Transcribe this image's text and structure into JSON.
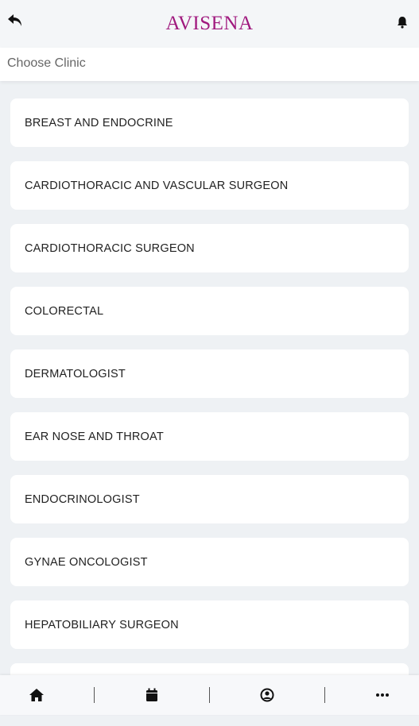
{
  "header": {
    "brand": "AVISENA",
    "back_icon": "back-arrow-icon",
    "bell_icon": "bell-icon"
  },
  "section": {
    "title": "Choose Clinic"
  },
  "clinics": [
    "BREAST AND ENDOCRINE",
    "CARDIOTHORACIC AND VASCULAR SURGEON",
    "CARDIOTHORACIC SURGEON",
    "COLORECTAL",
    "DERMATOLOGIST",
    "EAR NOSE AND THROAT",
    "ENDOCRINOLOGIST",
    "GYNAE ONCOLOGIST",
    "HEPATOBILIARY SURGEON",
    ""
  ],
  "bottom_nav": [
    {
      "icon": "home-icon"
    },
    {
      "icon": "calendar-icon"
    },
    {
      "icon": "profile-icon"
    },
    {
      "icon": "more-icon"
    }
  ],
  "colors": {
    "brand": "#a0197e",
    "background": "#eef1f4"
  }
}
